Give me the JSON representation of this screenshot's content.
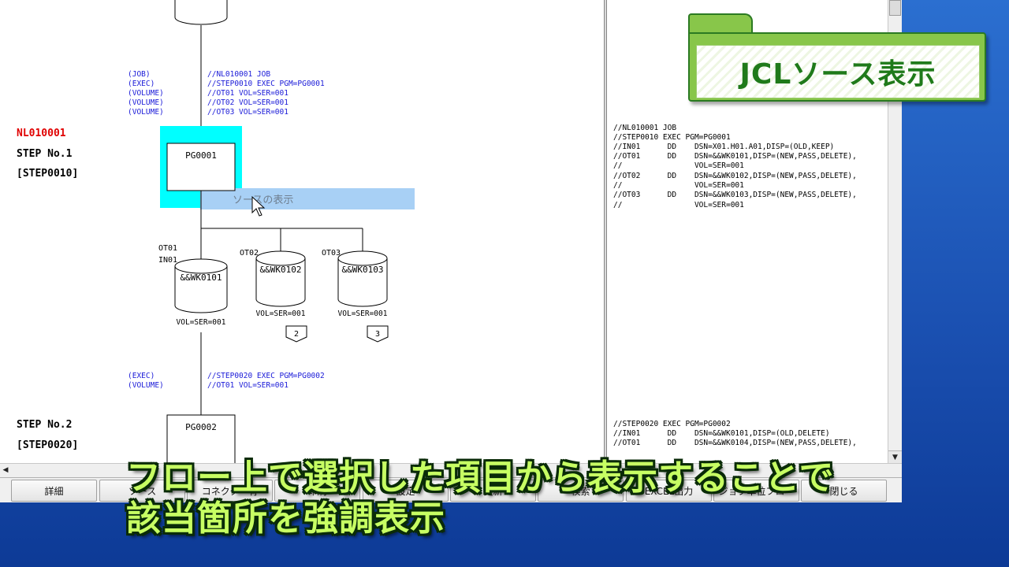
{
  "flow": {
    "job_name": "NL010001",
    "steps": [
      {
        "label": "STEP No.1",
        "name": "[STEP0010]",
        "program": "PG0001"
      },
      {
        "label": "STEP No.2",
        "name": "[STEP0020]",
        "program": "PG0002"
      }
    ],
    "step1_annotations": [
      {
        "tag": "(JOB)",
        "text": "//NL010001 JOB"
      },
      {
        "tag": "(EXEC)",
        "text": "//STEP0010 EXEC PGM=PG0001"
      },
      {
        "tag": "(VOLUME)",
        "text": "//OT01 VOL=SER=001"
      },
      {
        "tag": "(VOLUME)",
        "text": "//OT02 VOL=SER=001"
      },
      {
        "tag": "(VOLUME)",
        "text": "//OT03 VOL=SER=001"
      }
    ],
    "step2_annotations": [
      {
        "tag": "(EXEC)",
        "text": "//STEP0020 EXEC PGM=PG0002"
      },
      {
        "tag": "(VOLUME)",
        "text": "//OT01 VOL=SER=001"
      }
    ],
    "datasets": [
      {
        "dd1": "OT01",
        "dd2": "IN01",
        "name": "&&WK0101",
        "vol": "VOL=SER=001",
        "ref": ""
      },
      {
        "dd1": "OT02",
        "dd2": "",
        "name": "&&WK0102",
        "vol": "VOL=SER=001",
        "ref": "2"
      },
      {
        "dd1": "OT03",
        "dd2": "",
        "name": "&&WK0103",
        "vol": "VOL=SER=001",
        "ref": "3"
      }
    ],
    "context_menu_item": "ソースの表示"
  },
  "source": {
    "block1": [
      "//NL010001 JOB",
      "//STEP0010 EXEC PGM=PG0001",
      "//IN01      DD    DSN=X01.H01.A01,DISP=(OLD,KEEP)",
      "//OT01      DD    DSN=&&WK0101,DISP=(NEW,PASS,DELETE),",
      "//                VOL=SER=001",
      "//OT02      DD    DSN=&&WK0102,DISP=(NEW,PASS,DELETE),",
      "//                VOL=SER=001",
      "//OT03      DD    DSN=&&WK0103,DISP=(NEW,PASS,DELETE),",
      "//                VOL=SER=001"
    ],
    "block2": [
      "//STEP0020 EXEC PGM=PG0002",
      "//IN01      DD    DSN=&&WK0101,DISP=(OLD,DELETE)",
      "//OT01      DD    DSN=&&WK0104,DISP=(NEW,PASS,DELETE),"
    ]
  },
  "buttons": [
    "詳細",
    "ソース",
    "コネクター有",
    "印刷",
    "設定",
    "更新",
    "検索",
    "EXCEL出力",
    "ジョブ単位フロー",
    "閉じる"
  ],
  "banner": {
    "title": "JCLソース表示"
  },
  "captions": {
    "line1": "フロー上で選択した項目から表示することで",
    "line2": "該当箇所を強調表示"
  },
  "colors": {
    "highlight": "#00ffff",
    "menu_highlight": "#a8d0f5",
    "annotation_text": "#1a1ad8",
    "job_name": "#e00000",
    "caption_text": "#c7ff63",
    "banner_green": "#88c64a"
  }
}
